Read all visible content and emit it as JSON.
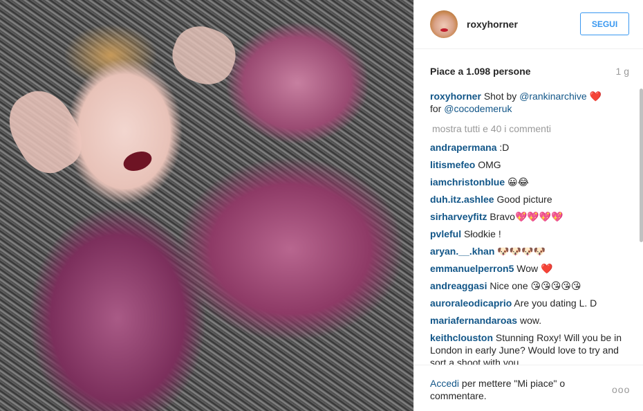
{
  "post": {
    "username": "roxyhorner",
    "follow_label": "SEGUI",
    "likes": "Piace a 1.098 persone",
    "time": "1 g",
    "caption": {
      "user": "roxyhorner",
      "text1": "Shot by ",
      "mention1": "@rankinarchive",
      "heart": "❤️",
      "text2": "for ",
      "mention2": "@cocodemeruk"
    },
    "load_more": "mostra tutti e 40 i commenti",
    "comments": [
      {
        "user": "andrapermana",
        "text": ":D"
      },
      {
        "user": "litismefeo",
        "text": "OMG"
      },
      {
        "user": "iamchristonblue",
        "text": "😀😂"
      },
      {
        "user": "duh.itz.ashlee",
        "text": "Good picture"
      },
      {
        "user": "sirharveyfitz",
        "text": "Bravo💖💖💖💖"
      },
      {
        "user": "pvleful",
        "text": "Słodkie !"
      },
      {
        "user": "aryan.__.khan",
        "text": "🐶🐶🐶🐶"
      },
      {
        "user": "emmanuelperron5",
        "text": "Wow ❤️"
      },
      {
        "user": "andreaggasi",
        "text": "Nice one 😘😘😘😘😘"
      },
      {
        "user": "auroraleodicaprio",
        "text": "Are you dating L. D"
      },
      {
        "user": "mariafernandaroas",
        "text": "wow."
      },
      {
        "user": "keithclouston",
        "text": "Stunning Roxy! Will you be in London in early June? Would love to try and sort a shoot with you."
      }
    ],
    "footer": {
      "login_link": "Accedi",
      "rest": " per mettere \"Mi piace\" o commentare."
    },
    "more_options": "ooo"
  }
}
